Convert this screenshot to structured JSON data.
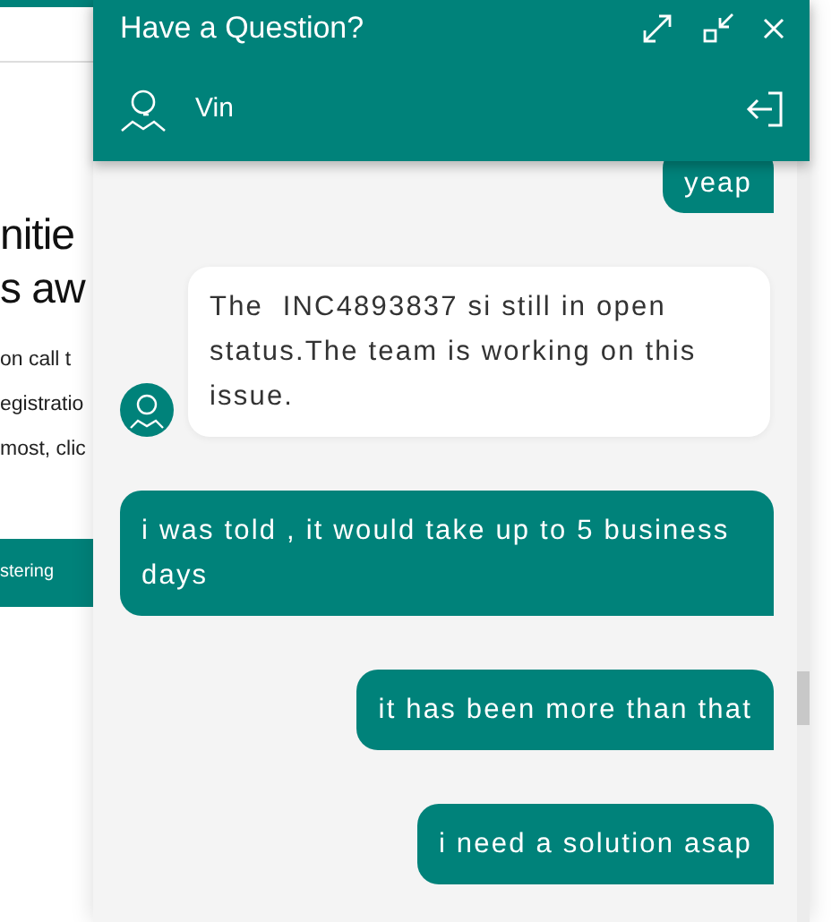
{
  "background_page": {
    "heading_lines": [
      "nitie",
      "s aw"
    ],
    "body_lines": [
      "on call t",
      "egistratio",
      "most, clic"
    ],
    "button": "stering"
  },
  "chat": {
    "title": "Have a Question?",
    "agent_name": "Vin",
    "messages": [
      {
        "kind": "outgoing",
        "text": "yeap"
      },
      {
        "kind": "incoming",
        "text": "The  INC4893837 si still in open status.The team is working on this issue."
      },
      {
        "kind": "outgoing",
        "text": "i was told , it would take up to 5 business days"
      },
      {
        "kind": "outgoing",
        "text": "it has been more than that"
      },
      {
        "kind": "outgoing",
        "text": "i need a solution asap"
      }
    ]
  }
}
